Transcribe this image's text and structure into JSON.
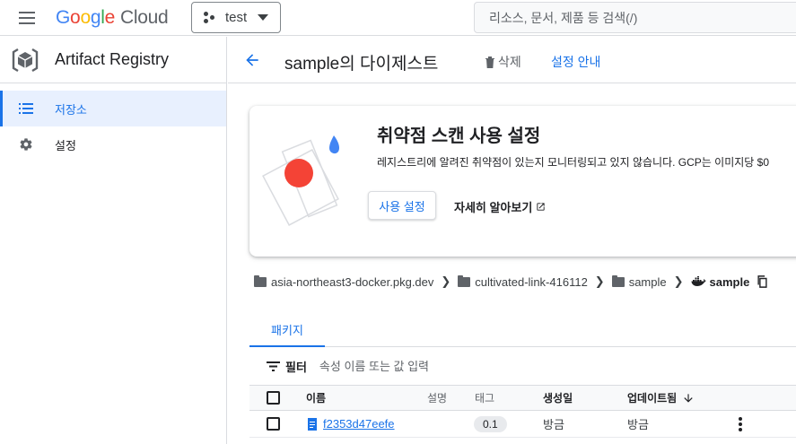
{
  "topbar": {
    "logo_word": "Google",
    "logo_product": "Cloud",
    "project_name": "test",
    "search_placeholder": "리소스, 문서, 제품 등 검색(/)"
  },
  "sidebar": {
    "product_name": "Artifact Registry",
    "items": [
      {
        "label": "저장소",
        "icon": "list-icon",
        "active": true
      },
      {
        "label": "설정",
        "icon": "gear-icon",
        "active": false
      }
    ]
  },
  "header": {
    "title": "sample의 다이제스트",
    "delete_label": "삭제",
    "guide_label": "설정 안내"
  },
  "scan_card": {
    "title": "취약점 스캔 사용 설정",
    "description": "레지스트리에 알려진 취약점이 있는지 모니터링되고 있지 않습니다. GCP는 이미지당 $0",
    "enable_label": "사용 설정",
    "learn_more_label": "자세히 알아보기"
  },
  "breadcrumb": [
    {
      "label": "asia-northeast3-docker.pkg.dev",
      "icon": "folder-icon"
    },
    {
      "label": "cultivated-link-416112",
      "icon": "folder-icon"
    },
    {
      "label": "sample",
      "icon": "folder-icon"
    },
    {
      "label": "sample",
      "icon": "docker-icon"
    }
  ],
  "tabs": [
    {
      "label": "패키지"
    }
  ],
  "filter": {
    "label": "필터",
    "placeholder": "속성 이름 또는 값 입력"
  },
  "table": {
    "columns": [
      "이름",
      "설명",
      "태그",
      "생성일",
      "업데이트됨"
    ],
    "sort_column": "업데이트됨",
    "rows": [
      {
        "name": "f2353d47eefe",
        "description": "",
        "tag": "0.1",
        "created": "방금",
        "updated": "방금"
      }
    ]
  },
  "colors": {
    "accent": "#1a73e8",
    "active_bg": "#e8f0fe",
    "scan_red": "#f44336",
    "scan_blue": "#4285f4"
  }
}
